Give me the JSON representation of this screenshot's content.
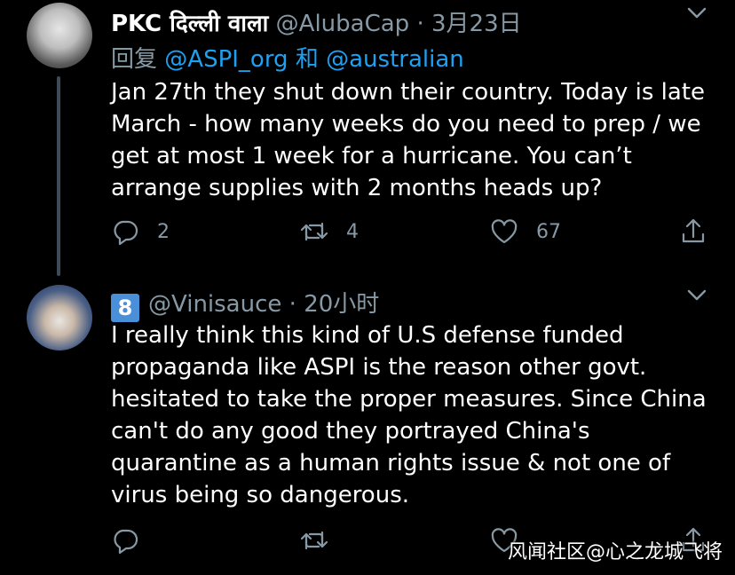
{
  "tweets": [
    {
      "name": "PKC दिल्ली वाला",
      "handle": "@AlubaCap",
      "separator": "·",
      "time": "3月23日",
      "reply_prefix": "回复",
      "reply_mentions": [
        "@ASPI_org",
        "@australian"
      ],
      "reply_joiner": "和",
      "text": "Jan 27th they shut down their country. Today is late March - how many weeks do you need to prep / we get at most 1 week for a hurricane. You can’t arrange supplies with 2 months heads up?",
      "replies": "2",
      "retweets": "4",
      "likes": "67"
    },
    {
      "badge": "8",
      "handle": "@Vinisauce",
      "separator": "·",
      "time": "20小时",
      "text": "I really think this kind of U.S defense funded propaganda like ASPI is the reason other govt. hesitated to take the proper measures. Since China can't do any good they portrayed China's quarantine as a human rights issue & not one of virus being so dangerous."
    }
  ],
  "watermark": "风闻社区@心之龙城飞将",
  "icons": {
    "reply": "reply-icon",
    "retweet": "retweet-icon",
    "like": "heart-icon",
    "share": "share-icon",
    "more": "chevron-down-icon"
  },
  "colors": {
    "background": "#000000",
    "secondary_text": "#8899a6",
    "link": "#1da1f2",
    "thread_line": "#3d4a57"
  }
}
